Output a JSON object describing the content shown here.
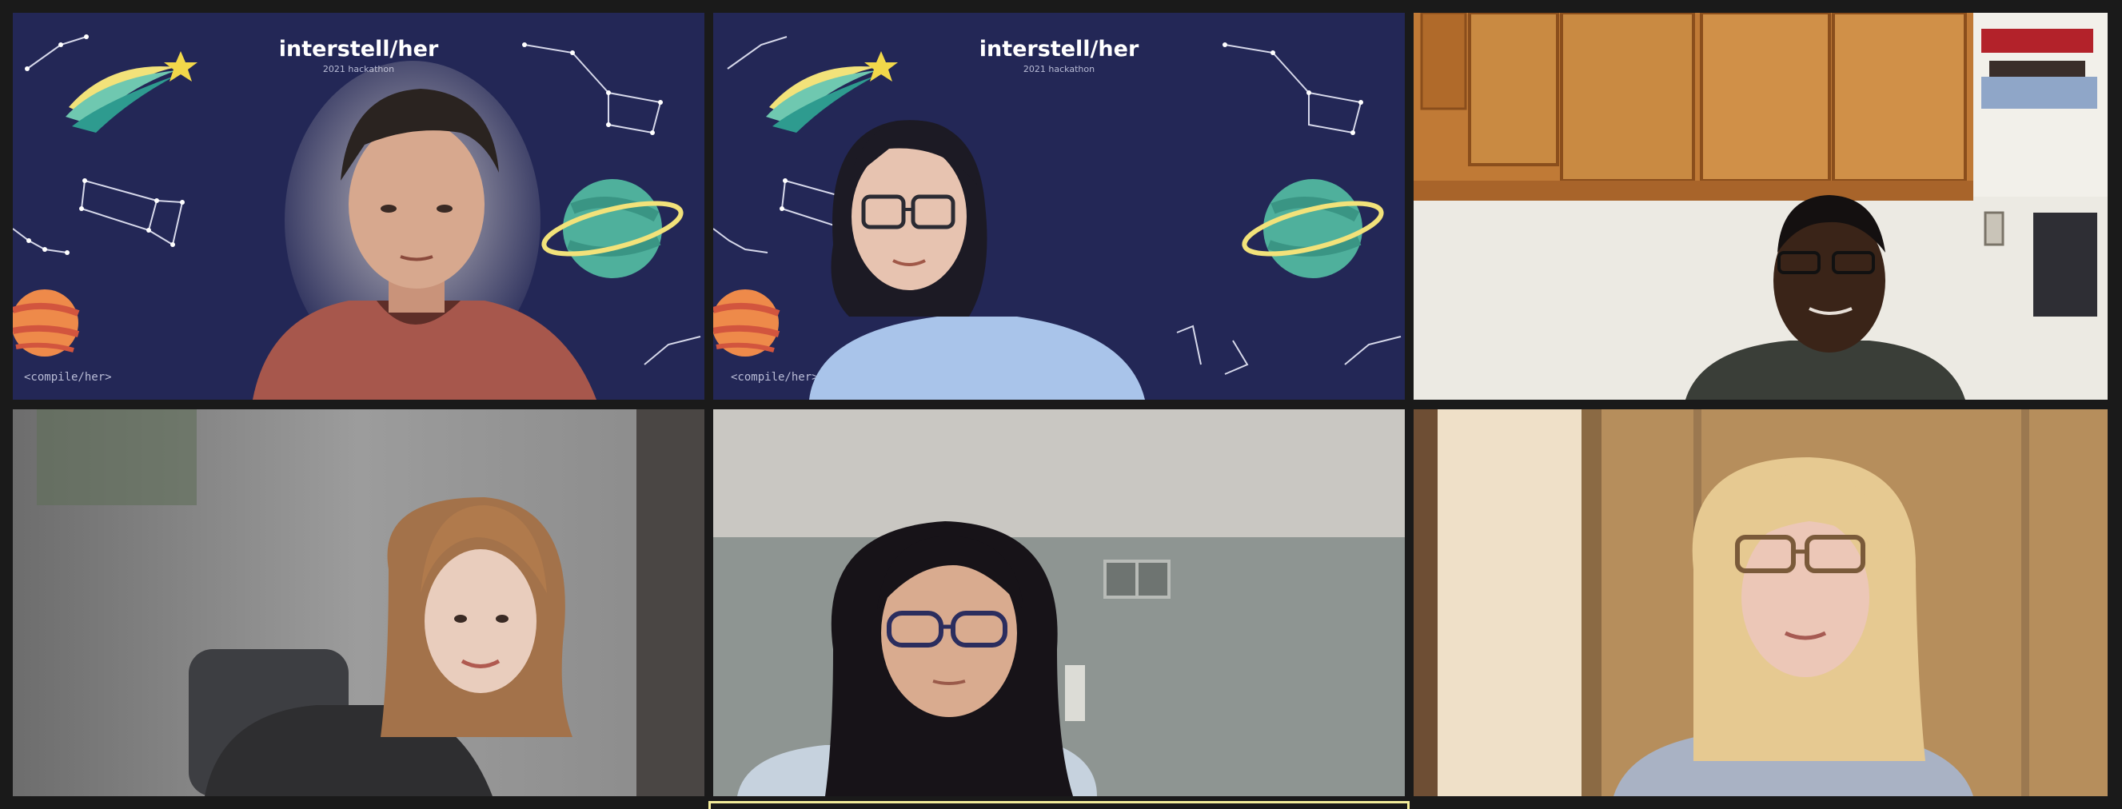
{
  "meeting": {
    "layout": "gallery-view",
    "active_speaker_tile": 2,
    "colors": {
      "active_border": "#f3ec9a",
      "background": "#1a1a1a",
      "space_backdrop": "#232756"
    }
  },
  "tiles": [
    {
      "id": 1,
      "background": "virtual-space",
      "brand_title": "interstell/her",
      "brand_subtitle": "2021 hackathon",
      "corner_tag": "<compile/her>"
    },
    {
      "id": 2,
      "background": "virtual-space",
      "brand_title": "interstell/her",
      "brand_subtitle": "2021 hackathon",
      "corner_tag": "<compile/her>"
    },
    {
      "id": 3,
      "background": "kitchen-cabinets"
    },
    {
      "id": 4,
      "background": "blurred-room"
    },
    {
      "id": 5,
      "background": "gray-wall"
    },
    {
      "id": 6,
      "background": "wooden-wall"
    }
  ]
}
